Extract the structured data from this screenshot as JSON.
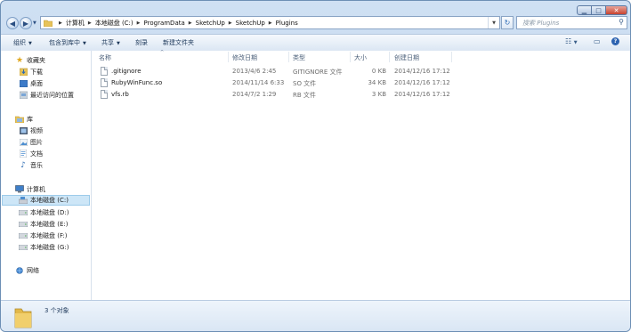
{
  "address": {
    "crumbs": [
      "计算机",
      "本地磁盘 (C:)",
      "ProgramData",
      "SketchUp",
      "SketchUp",
      "Plugins"
    ]
  },
  "search": {
    "placeholder": "搜索 Plugins"
  },
  "toolbar": {
    "organize": "组织",
    "include_in_library": "包含到库中",
    "share": "共享",
    "burn": "刻录",
    "new_folder": "新建文件夹"
  },
  "sidebar": {
    "favorites": {
      "label": "收藏夹",
      "items": [
        "下载",
        "桌面",
        "最近访问的位置"
      ]
    },
    "libraries": {
      "label": "库",
      "items": [
        "视频",
        "图片",
        "文档",
        "音乐"
      ]
    },
    "computer": {
      "label": "计算机",
      "items": [
        "本地磁盘 (C:)",
        "本地磁盘 (D:)",
        "本地磁盘 (E:)",
        "本地磁盘 (F:)",
        "本地磁盘 (G:)"
      ]
    },
    "network": {
      "label": "网络"
    }
  },
  "columns": {
    "name": "名称",
    "modified": "修改日期",
    "type": "类型",
    "size": "大小",
    "created": "创建日期"
  },
  "files": [
    {
      "name": ".gitignore",
      "modified": "2013/4/6 2:45",
      "type": "GITIGNORE 文件",
      "size": "0 KB",
      "created": "2014/12/16 17:12"
    },
    {
      "name": "RubyWinFunc.so",
      "modified": "2014/11/14 6:33",
      "type": "SO 文件",
      "size": "34 KB",
      "created": "2014/12/16 17:12"
    },
    {
      "name": "vfs.rb",
      "modified": "2014/7/2 1:29",
      "type": "RB 文件",
      "size": "3 KB",
      "created": "2014/12/16 17:12"
    }
  ],
  "status": {
    "count": "3 个对象"
  }
}
